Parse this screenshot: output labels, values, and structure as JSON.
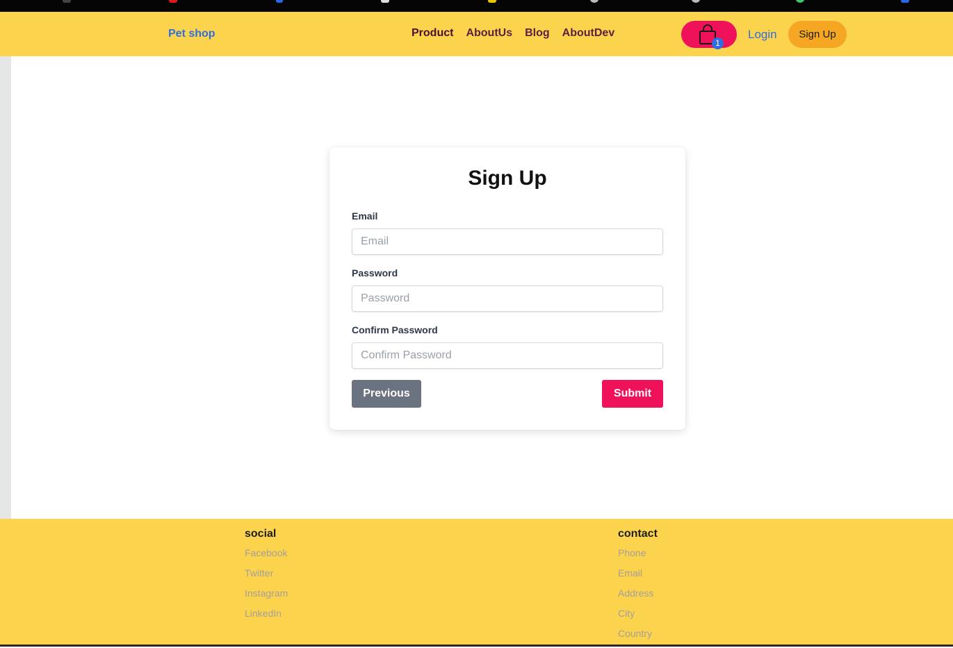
{
  "navbar": {
    "brand": "Pet shop",
    "links": [
      "Product",
      "AboutUs",
      "Blog",
      "AboutDev"
    ],
    "cart_count": "1",
    "login": "Login",
    "signup": "Sign Up"
  },
  "form": {
    "title": "Sign Up",
    "email_label": "Email",
    "email_placeholder": "Email",
    "password_label": "Password",
    "password_placeholder": "Password",
    "confirm_label": "Confirm Password",
    "confirm_placeholder": "Confirm Password",
    "previous_button": "Previous",
    "submit_button": "Submit"
  },
  "footer": {
    "social_heading": "social",
    "social_links": [
      "Facebook",
      "Twitter",
      "Instagram",
      "LinkedIn"
    ],
    "contact_heading": "contact",
    "contact_links": [
      "Phone",
      "Email",
      "Address",
      "City",
      "Country"
    ]
  },
  "colors": {
    "navbar_bg": "#fcd34d",
    "brand_blue": "#2f6de1",
    "accent_pink": "#f0115b",
    "signup_orange": "#f5a623",
    "secondary_gray": "#6b7280"
  },
  "icons": [
    "shopping-bag-icon"
  ]
}
